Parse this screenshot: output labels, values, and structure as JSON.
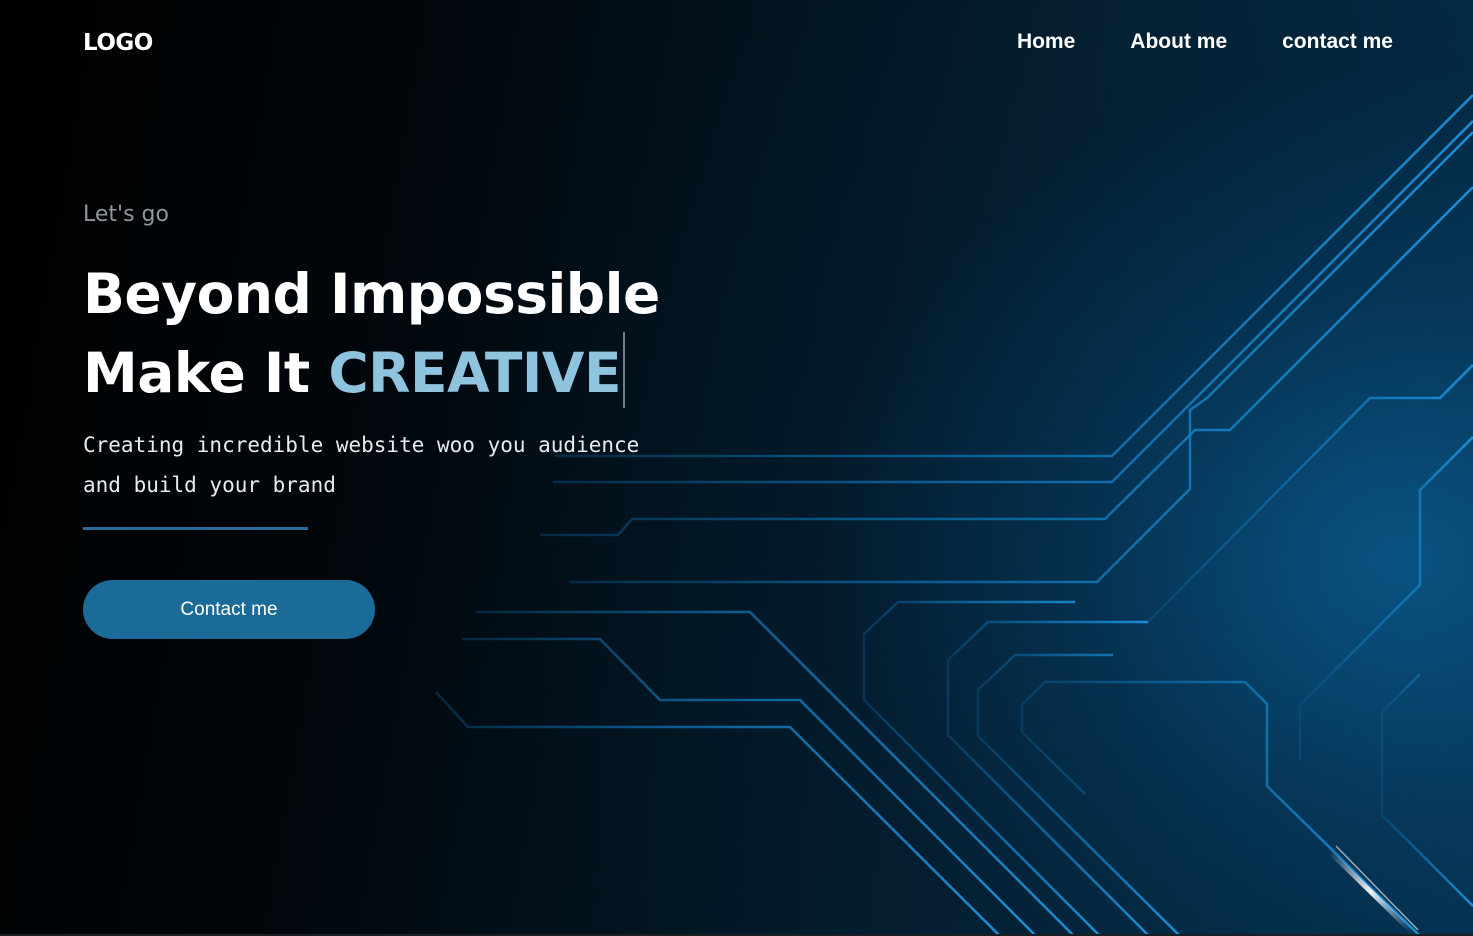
{
  "header": {
    "logo_text": "LOGO",
    "nav": [
      {
        "label": "Home"
      },
      {
        "label": "About me"
      },
      {
        "label": "contact me"
      }
    ]
  },
  "hero": {
    "eyebrow": "Let's go",
    "headline_line1": "Beyond Impossible",
    "headline_line2_prefix": "Make It ",
    "headline_line2_accent": "CREATIVE",
    "description_line1": "Creating incredible website woo you audience",
    "description_line2": "and build your brand",
    "cta_label": "Contact me"
  },
  "colors": {
    "accent_text": "#8fc4de",
    "button_bg": "#1b6b99",
    "circuit_line": "#0f6ba8",
    "background": "#000000"
  },
  "icons": {
    "background_art": "circuit-lines"
  }
}
